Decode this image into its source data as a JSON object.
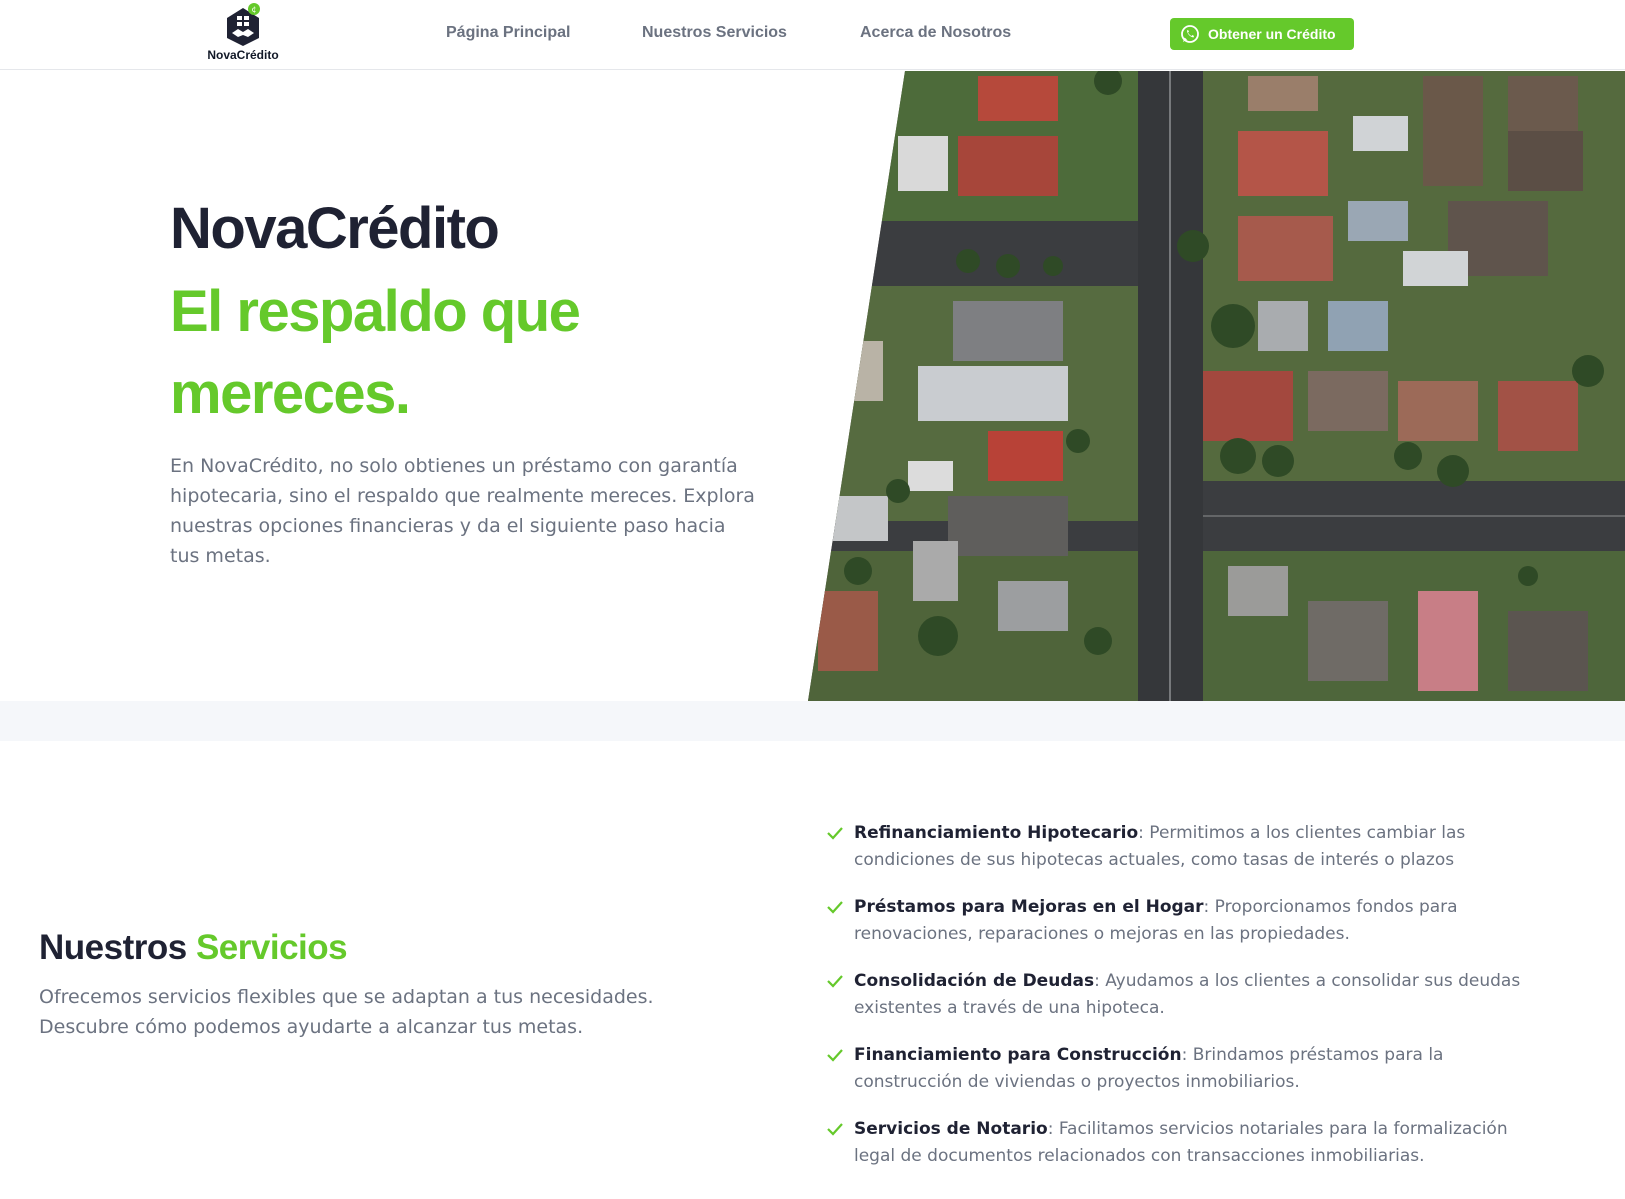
{
  "header": {
    "logo_text": "NovaCrédito",
    "nav": {
      "home": "Página Principal",
      "services": "Nuestros Servicios",
      "about": "Acerca de Nosotros"
    },
    "cta_label": "Obtener un Crédito"
  },
  "hero": {
    "title": "NovaCrédito",
    "subtitle": "El respaldo que mereces.",
    "description": "En NovaCrédito, no solo obtienes un préstamo con garantía hipotecaria, sino el respaldo que realmente mereces. Explora nuestras opciones financieras y da el siguiente paso hacia tus metas."
  },
  "services": {
    "title_main": "Nuestros",
    "title_accent": "Servicios",
    "description": "Ofrecemos servicios flexibles que se adaptan a tus necesidades. Descubre cómo podemos ayudarte a alcanzar tus metas.",
    "items": [
      {
        "name": "Refinanciamiento Hipotecario",
        "text": ": Permitimos a los clientes cambiar las condiciones de sus hipotecas actuales, como tasas de interés o plazos"
      },
      {
        "name": "Préstamos para Mejoras en el Hogar",
        "text": ": Proporcionamos fondos para renovaciones, reparaciones o mejoras en las propiedades."
      },
      {
        "name": "Consolidación de Deudas",
        "text": ": Ayudamos a los clientes a consolidar sus deudas existentes a través de una hipoteca."
      },
      {
        "name": "Financiamiento para Construcción",
        "text": ": Brindamos préstamos para la construcción de viviendas o proyectos inmobiliarios."
      },
      {
        "name": "Servicios de Notario",
        "text": ": Facilitamos servicios notariales para la formalización legal de documentos relacionados con transacciones inmobiliarias."
      }
    ]
  },
  "colors": {
    "accent": "#65c92b",
    "heading": "#1f2233",
    "body_text": "#6b7280",
    "band": "#f5f7fa"
  },
  "icons": {
    "logo": "house-handshake-logo",
    "cta": "whatsapp-icon",
    "list": "check-icon"
  }
}
